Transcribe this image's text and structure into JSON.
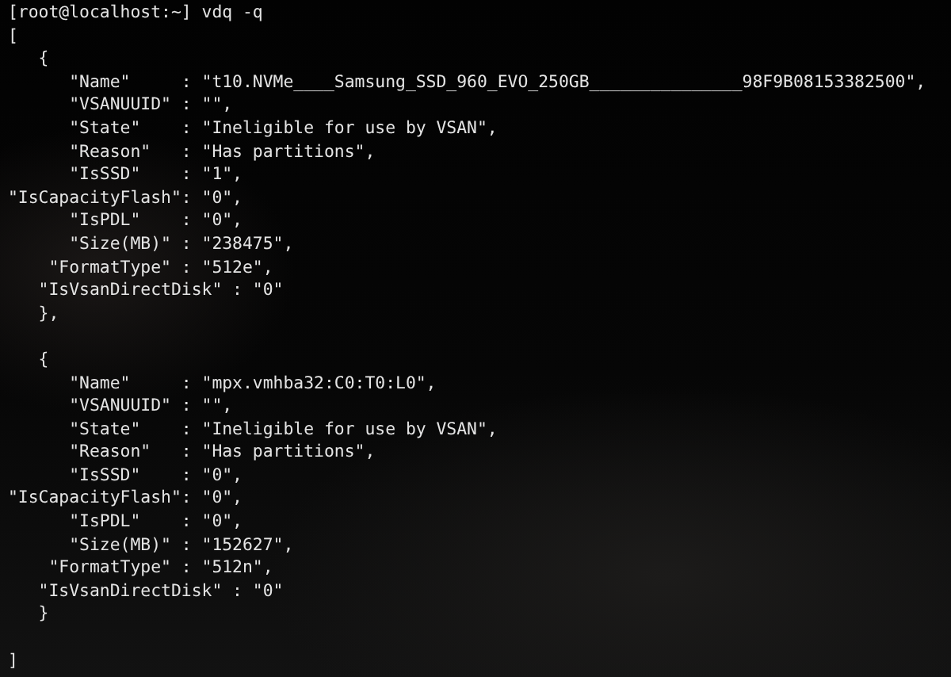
{
  "terminal": {
    "lines": [
      {
        "kind": "text",
        "text": "[root@localhost:~] vdq -q"
      },
      {
        "kind": "text",
        "text": "["
      },
      {
        "kind": "text",
        "text": "   {"
      },
      {
        "kind": "text",
        "text": "      \"Name\"     : \"t10.NVMe____Samsung_SSD_960_EVO_250GB_______________98F9B08153382500\","
      },
      {
        "kind": "text",
        "text": "      \"VSANUUID\" : \"\","
      },
      {
        "kind": "text",
        "text": "      \"State\"    : \"Ineligible for use by VSAN\","
      },
      {
        "kind": "text",
        "text": "      \"Reason\"   : \"Has partitions\","
      },
      {
        "kind": "text",
        "text": "      \"IsSSD\"    : \"1\","
      },
      {
        "kind": "text",
        "text": "\"IsCapacityFlash\": \"0\","
      },
      {
        "kind": "text",
        "text": "      \"IsPDL\"    : \"0\","
      },
      {
        "kind": "text",
        "text": "      \"Size(MB)\" : \"238475\","
      },
      {
        "kind": "text",
        "text": "    \"FormatType\" : \"512e\","
      },
      {
        "kind": "text",
        "text": "   \"IsVsanDirectDisk\" : \"0\""
      },
      {
        "kind": "text",
        "text": "   },"
      },
      {
        "kind": "blank"
      },
      {
        "kind": "text",
        "text": "   {"
      },
      {
        "kind": "text",
        "text": "      \"Name\"     : \"mpx.vmhba32:C0:T0:L0\","
      },
      {
        "kind": "text",
        "text": "      \"VSANUUID\" : \"\","
      },
      {
        "kind": "text",
        "text": "      \"State\"    : \"Ineligible for use by VSAN\","
      },
      {
        "kind": "text",
        "text": "      \"Reason\"   : \"Has partitions\","
      },
      {
        "kind": "text",
        "text": "      \"IsSSD\"    : \"0\","
      },
      {
        "kind": "text",
        "text": "\"IsCapacityFlash\": \"0\","
      },
      {
        "kind": "text",
        "text": "      \"IsPDL\"    : \"0\","
      },
      {
        "kind": "text",
        "text": "      \"Size(MB)\" : \"152627\","
      },
      {
        "kind": "text",
        "text": "    \"FormatType\" : \"512n\","
      },
      {
        "kind": "text",
        "text": "   \"IsVsanDirectDisk\" : \"0\""
      },
      {
        "kind": "text",
        "text": "   }"
      },
      {
        "kind": "blank"
      },
      {
        "kind": "text",
        "text": "]"
      }
    ]
  }
}
